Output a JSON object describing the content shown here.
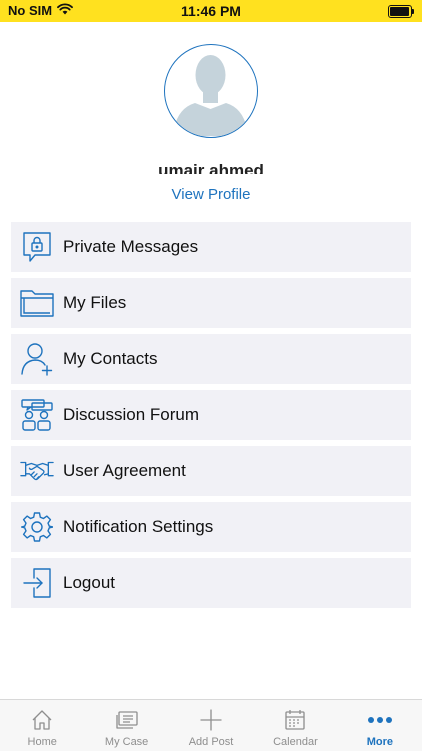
{
  "status_bar": {
    "carrier": "No SIM",
    "time": "11:46 PM",
    "background_color": "#FFE11F"
  },
  "profile": {
    "username": "umair ahmed",
    "view_profile_label": "View Profile",
    "accent_color": "#1E73BE"
  },
  "menu": {
    "items": [
      {
        "label": "Private Messages",
        "icon": "lock-message-icon"
      },
      {
        "label": "My Files",
        "icon": "folder-icon"
      },
      {
        "label": "My Contacts",
        "icon": "add-contact-icon"
      },
      {
        "label": "Discussion Forum",
        "icon": "forum-icon"
      },
      {
        "label": "User Agreement",
        "icon": "handshake-icon"
      },
      {
        "label": "Notification Settings",
        "icon": "gear-icon"
      },
      {
        "label": "Logout",
        "icon": "logout-icon"
      }
    ]
  },
  "tab_bar": {
    "tabs": [
      {
        "label": "Home",
        "icon": "home-icon"
      },
      {
        "label": "My Case",
        "icon": "case-icon"
      },
      {
        "label": "Add Post",
        "icon": "plus-icon"
      },
      {
        "label": "Calendar",
        "icon": "calendar-icon"
      },
      {
        "label": "More",
        "icon": "more-dots-icon",
        "active": true
      }
    ]
  }
}
